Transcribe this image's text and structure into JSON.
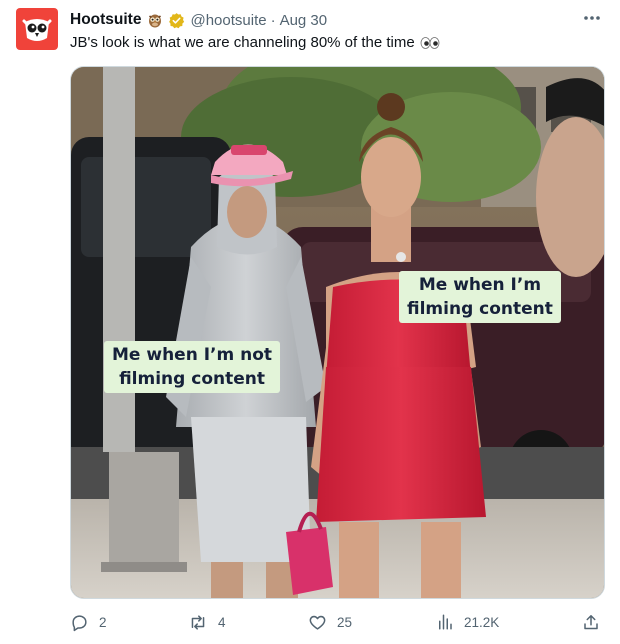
{
  "tweet": {
    "author_name": "Hootsuite",
    "handle": "@hootsuite",
    "separator": "·",
    "date": "Aug 30",
    "text": "JB's look is what we are channeling 80% of the time",
    "icons": {
      "avatar": "hootsuite-owl-logo",
      "name_emoji": "owl-emoji",
      "verified": "gold-verified-badge",
      "text_emoji": "eyes-emoji",
      "more": "more-horizontal-icon"
    },
    "colors": {
      "brand": "#f0433a",
      "verified": "#e2b719",
      "secondary_text": "#536471",
      "caption_bg": "#e3f4d9"
    }
  },
  "media": {
    "caption_right": {
      "line1": "Me when I’m",
      "line2": "filming content"
    },
    "caption_left": {
      "line1": "Me when I’m not",
      "line2": "filming content"
    }
  },
  "actions": {
    "reply_count": "2",
    "retweet_count": "4",
    "like_count": "25",
    "views_count": "21.2K"
  }
}
